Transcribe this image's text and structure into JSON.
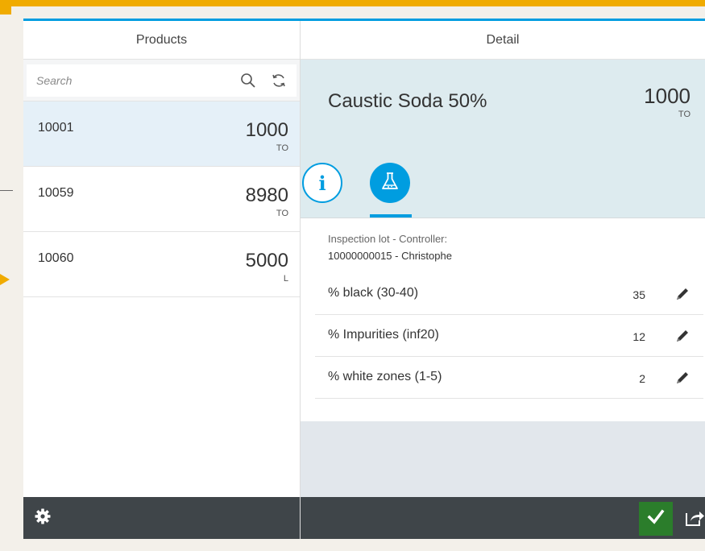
{
  "master": {
    "title": "Products",
    "search": {
      "placeholder": "Search",
      "value": ""
    },
    "items": [
      {
        "id": "10001",
        "number": "1000",
        "unit": "TO",
        "selected": true
      },
      {
        "id": "10059",
        "number": "8980",
        "unit": "TO",
        "selected": false
      },
      {
        "id": "10060",
        "number": "5000",
        "unit": "L",
        "selected": false
      }
    ],
    "footer": {
      "settings_icon": "gear-icon"
    }
  },
  "detail": {
    "title": "Detail",
    "object": {
      "title": "Caustic Soda 50%",
      "number": "1000",
      "unit": "TO"
    },
    "tabs": [
      {
        "name": "info",
        "icon": "info-icon",
        "selected": false
      },
      {
        "name": "lab",
        "icon": "flask-icon",
        "selected": true
      }
    ],
    "controller_label": "Inspection lot - Controller:",
    "controller_value": "10000000015 - Christophe",
    "criteria": [
      {
        "label": "% black (30-40)",
        "value": "35"
      },
      {
        "label": "% Impurities (inf20)",
        "value": "12"
      },
      {
        "label": "% white zones (1-5)",
        "value": "2"
      }
    ],
    "footer": {
      "accept_icon": "checkmark-icon",
      "share_icon": "share-icon"
    }
  },
  "colors": {
    "accent": "#009de0",
    "frame": "#f0ab00",
    "footer": "#3f4549",
    "accept": "#2b7d2b",
    "selected_row": "#e5f0f8",
    "object_header": "#ddebef"
  }
}
